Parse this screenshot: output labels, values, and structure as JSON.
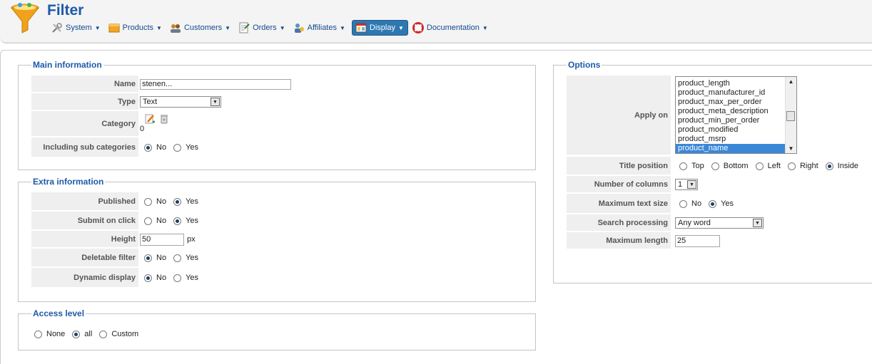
{
  "header": {
    "title": "Filter",
    "menu": [
      {
        "label": "System",
        "icon": "tools-icon"
      },
      {
        "label": "Products",
        "icon": "products-icon"
      },
      {
        "label": "Customers",
        "icon": "customers-icon"
      },
      {
        "label": "Orders",
        "icon": "orders-icon"
      },
      {
        "label": "Affiliates",
        "icon": "affiliates-icon"
      },
      {
        "label": "Display",
        "icon": "display-icon",
        "active": true
      },
      {
        "label": "Documentation",
        "icon": "lifebuoy-icon"
      }
    ]
  },
  "main_info": {
    "legend": "Main information",
    "name_label": "Name",
    "name_value": "stenen...",
    "type_label": "Type",
    "type_value": "Text",
    "category_label": "Category",
    "category_value": "0",
    "subcat_label": "Including sub categories",
    "opt_no": "No",
    "opt_yes": "Yes",
    "subcat_selected": "No"
  },
  "extra_info": {
    "legend": "Extra information",
    "published_label": "Published",
    "published_selected": "Yes",
    "submit_label": "Submit on click",
    "submit_selected": "Yes",
    "height_label": "Height",
    "height_value": "50",
    "height_unit": "px",
    "deletable_label": "Deletable filter",
    "deletable_selected": "No",
    "dynamic_label": "Dynamic display",
    "dynamic_selected": "No",
    "opt_no": "No",
    "opt_yes": "Yes"
  },
  "access": {
    "legend": "Access level",
    "opt_none": "None",
    "opt_all": "all",
    "opt_custom": "Custom",
    "selected": "all"
  },
  "options": {
    "legend": "Options",
    "apply_label": "Apply on",
    "apply_items": [
      "product_length",
      "product_manufacturer_id",
      "product_max_per_order",
      "product_meta_description",
      "product_min_per_order",
      "product_modified",
      "product_msrp",
      "product_name"
    ],
    "apply_selected": "product_name",
    "title_pos_label": "Title position",
    "title_pos_opts": [
      "Top",
      "Bottom",
      "Left",
      "Right",
      "Inside"
    ],
    "title_pos_selected": "Inside",
    "columns_label": "Number of columns",
    "columns_value": "1",
    "max_text_label": "Maximum text size",
    "opt_no": "No",
    "opt_yes": "Yes",
    "max_text_selected": "Yes",
    "search_label": "Search processing",
    "search_value": "Any word",
    "max_len_label": "Maximum length",
    "max_len_value": "25"
  }
}
